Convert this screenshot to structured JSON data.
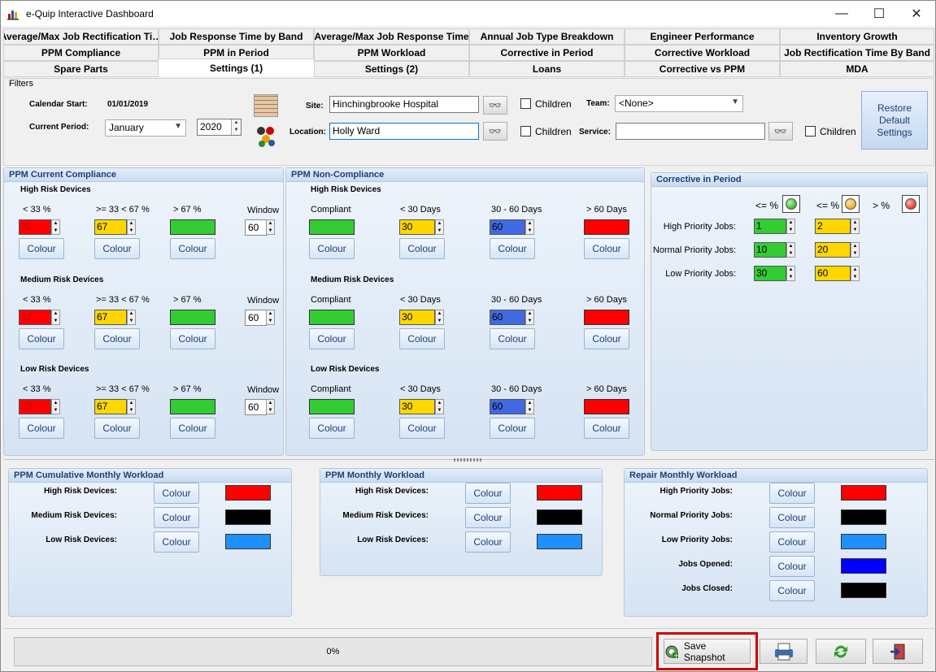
{
  "window": {
    "title": "e-Quip Interactive Dashboard",
    "min": "—",
    "max": "☐",
    "close": "✕"
  },
  "tabs": {
    "row1": [
      "Average/Max Job Rectification Ti…",
      "Job Response Time by Band",
      "Average/Max Job Response Time",
      "Annual Job Type Breakdown",
      "Engineer Performance",
      "Inventory Growth"
    ],
    "row2": [
      "PPM Compliance",
      "PPM in Period",
      "PPM Workload",
      "Corrective in Period",
      "Corrective Workload",
      "Job Rectification Time By Band"
    ],
    "row3": [
      "Spare Parts",
      "Settings (1)",
      "Settings (2)",
      "Loans",
      "Corrective vs PPM",
      "MDA"
    ]
  },
  "filters": {
    "legend": "Filters",
    "calendar_start_label": "Calendar Start:",
    "calendar_start_value": "01/01/2019",
    "current_period_label": "Current Period:",
    "period_month": "January",
    "period_year": "2020",
    "site_label": "Site:",
    "site_value": "Hinchingbrooke Hospital",
    "location_label": "Location:",
    "location_value": "Holly Ward",
    "children_label": "Children",
    "team_label": "Team:",
    "team_value": "<None>",
    "service_label": "Service:",
    "service_value": "",
    "restore_label": "Restore Default Settings"
  },
  "common": {
    "colour": "Colour",
    "window": "Window",
    "lt33": "< 33 %",
    "mid": ">= 33 < 67 %",
    "gt67": "> 67 %",
    "compliant": "Compliant",
    "lt30": "< 30 Days",
    "d3060": "30 - 60 Days",
    "gt60": "> 60 Days"
  },
  "ppm_compliance": {
    "title": "PPM Current Compliance",
    "groups": [
      {
        "label": "High Risk Devices",
        "low": "33",
        "mid": "67",
        "window": "60"
      },
      {
        "label": "Medium Risk Devices",
        "low": "33",
        "mid": "67",
        "window": "60"
      },
      {
        "label": "Low Risk Devices",
        "low": "33",
        "mid": "67",
        "window": "60"
      }
    ]
  },
  "ppm_noncompliance": {
    "title": "PPM Non-Compliance",
    "groups": [
      {
        "label": "High Risk Devices",
        "d30": "30",
        "d60": "60"
      },
      {
        "label": "Medium Risk Devices",
        "d30": "30",
        "d60": "60"
      },
      {
        "label": "Low Risk Devices",
        "d30": "30",
        "d60": "60"
      }
    ]
  },
  "corrective": {
    "title": "Corrective in Period",
    "le1": "<= %",
    "le2": "<= %",
    "gt": "> %",
    "rows": [
      {
        "label": "High Priority Jobs:",
        "a": "1",
        "b": "2"
      },
      {
        "label": "Normal Priority Jobs:",
        "a": "10",
        "b": "20"
      },
      {
        "label": "Low Priority Jobs:",
        "a": "30",
        "b": "60"
      }
    ]
  },
  "cumulative": {
    "title": "PPM Cumulative Monthly Workload",
    "rows": [
      "High Risk Devices:",
      "Medium Risk Devices:",
      "Low Risk Devices:"
    ]
  },
  "monthly": {
    "title": "PPM Monthly Workload",
    "rows": [
      "High Risk Devices:",
      "Medium Risk Devices:",
      "Low Risk Devices:"
    ]
  },
  "repair": {
    "title": "Repair Monthly Workload",
    "rows": [
      "High Priority Jobs:",
      "Normal Priority Jobs:",
      "Low Priority Jobs:",
      "Jobs Opened:",
      "Jobs Closed:"
    ]
  },
  "footer": {
    "progress": "0%",
    "save_snapshot": "Save Snapshot"
  },
  "colors": {
    "red": "#ff0000",
    "yellow": "#ffd700",
    "green": "#33cc33",
    "blue": "#4169e1",
    "black": "#000000",
    "sky": "#1e90ff",
    "deep_blue": "#0000ff",
    "highlight": "#d00000"
  }
}
